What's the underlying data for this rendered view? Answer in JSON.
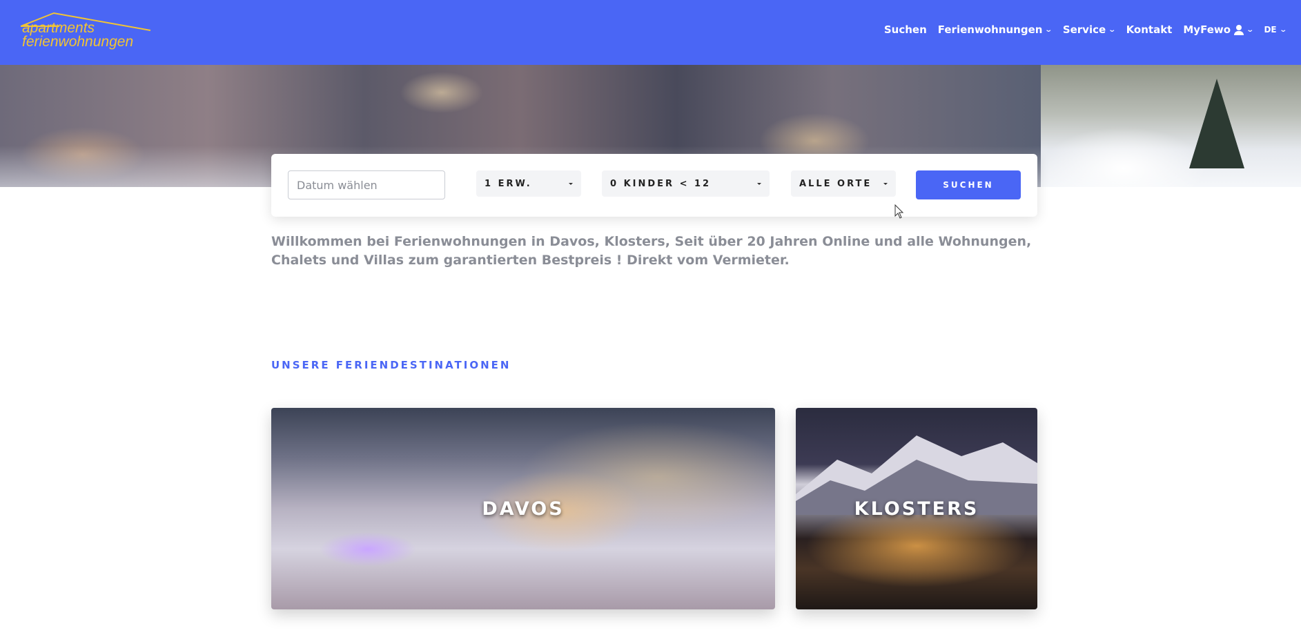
{
  "header": {
    "logo": {
      "line1": "apartments",
      "line2": "ferienwohnungen"
    },
    "nav": [
      {
        "label": "Suchen",
        "dropdown": false
      },
      {
        "label": "Ferienwohnungen",
        "dropdown": true
      },
      {
        "label": "Service",
        "dropdown": true
      },
      {
        "label": "Kontakt",
        "dropdown": false
      },
      {
        "label": "MyFewo",
        "dropdown": true
      },
      {
        "label": "DE",
        "dropdown": true
      }
    ]
  },
  "search": {
    "date_placeholder": "Datum wählen",
    "adults": "1 ERW.",
    "children": "0 KINDER < 12",
    "location": "ALLE ORTE",
    "submit": "SUCHEN"
  },
  "intro": "Willkommen bei Ferienwohnungen in Davos, Klosters, Seit über 20 Jahren Online und alle Wohnungen, Chalets und Villas zum garantierten Bestpreis ! Direkt vom Vermieter.",
  "destinations": {
    "heading": "UNSERE FERIENDESTINATIONEN",
    "items": [
      {
        "label": "DAVOS"
      },
      {
        "label": "KLOSTERS"
      }
    ]
  },
  "colors": {
    "primary": "#4a66f5",
    "logo": "#f2c434",
    "intro_text": "#8a8d96"
  }
}
